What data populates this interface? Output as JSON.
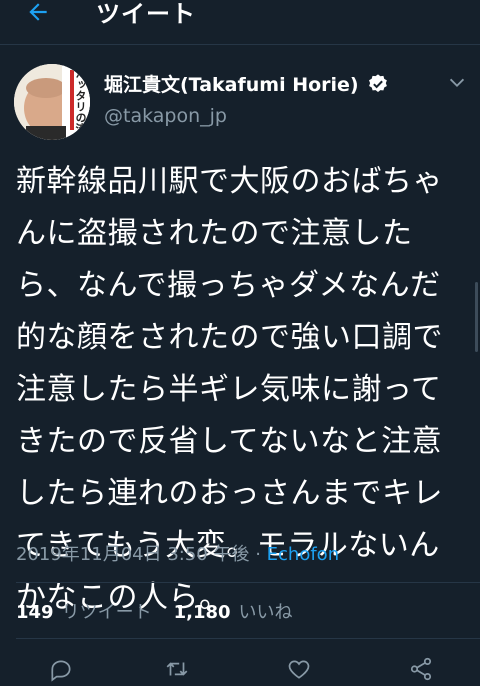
{
  "header": {
    "title": "ツイート",
    "back_icon": "arrow-left-icon"
  },
  "tweet": {
    "display_name": "堀江貴文(Takafumi Horie)",
    "handle": "@takapon_jp",
    "avatar_text": "ハッタリの流",
    "text": "新幹線品川駅で大阪のおばちゃ\nんに盗撮されたので注意した\nら、なんで撮っちゃダメなんだ\n的な顔をされたので強い口調で\n注意したら半ギレ気味に謝って\nきたので反省してないなと注意\nしたら連れのおっさんまでキレ\nてきてもう大変。モラルないん\nかなこの人ら。",
    "timestamp": "2019年11月04日 3:50 午後",
    "separator": " · ",
    "source": "Echofon"
  },
  "stats": {
    "retweets_count": "149",
    "retweets_label": "リツイート",
    "likes_count": "1,180",
    "likes_label": "いいね"
  },
  "colors": {
    "background": "#15202b",
    "secondary_text": "#8899a6",
    "accent": "#1da1f2"
  }
}
